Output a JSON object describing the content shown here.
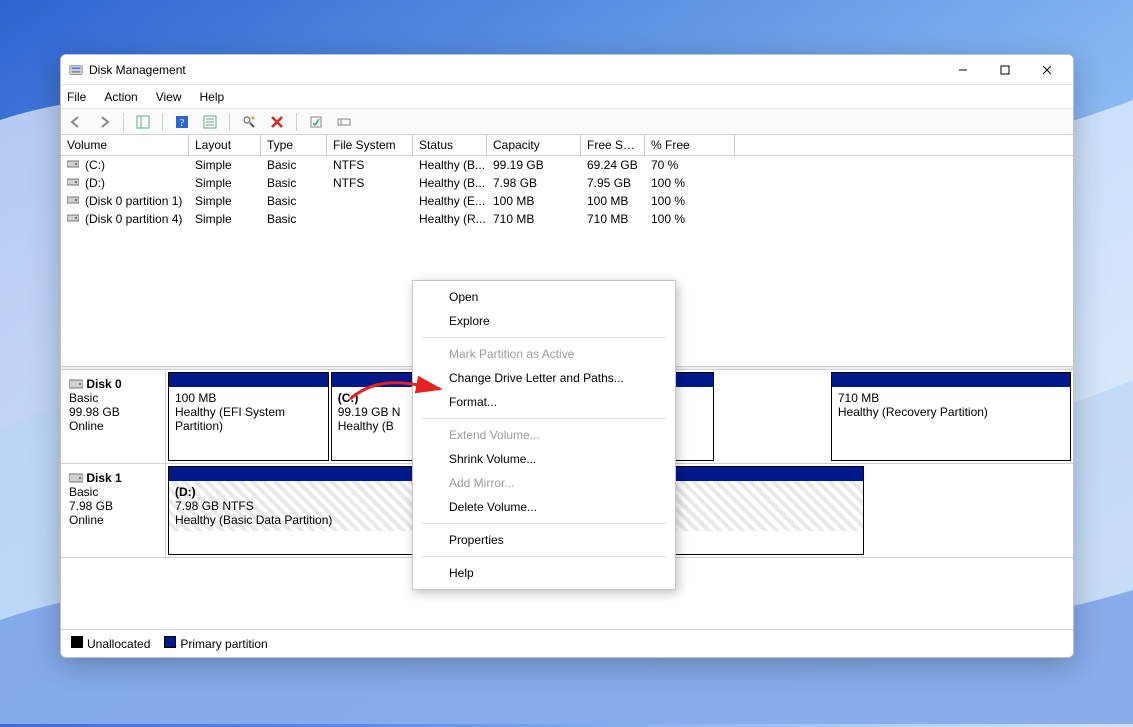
{
  "window": {
    "title": "Disk Management"
  },
  "menubar": {
    "file": "File",
    "action": "Action",
    "view": "View",
    "help": "Help"
  },
  "columns": {
    "volume": "Volume",
    "layout": "Layout",
    "type": "Type",
    "fs": "File System",
    "status": "Status",
    "capacity": "Capacity",
    "freespace": "Free Spa...",
    "pctfree": "% Free"
  },
  "col_widths": {
    "volume": 128,
    "layout": 72,
    "type": 66,
    "fs": 86,
    "status": 74,
    "capacity": 94,
    "freespace": 64,
    "pctfree": 90
  },
  "volumes": [
    {
      "name": "(C:)",
      "layout": "Simple",
      "type": "Basic",
      "fs": "NTFS",
      "status": "Healthy (B...",
      "capacity": "99.19 GB",
      "freespace": "69.24 GB",
      "pctfree": "70 %"
    },
    {
      "name": "(D:)",
      "layout": "Simple",
      "type": "Basic",
      "fs": "NTFS",
      "status": "Healthy (B...",
      "capacity": "7.98 GB",
      "freespace": "7.95 GB",
      "pctfree": "100 %"
    },
    {
      "name": "(Disk 0 partition 1)",
      "layout": "Simple",
      "type": "Basic",
      "fs": "",
      "status": "Healthy (E...",
      "capacity": "100 MB",
      "freespace": "100 MB",
      "pctfree": "100 %"
    },
    {
      "name": "(Disk 0 partition 4)",
      "layout": "Simple",
      "type": "Basic",
      "fs": "",
      "status": "Healthy (R...",
      "capacity": "710 MB",
      "freespace": "710 MB",
      "pctfree": "100 %"
    }
  ],
  "disks": [
    {
      "name": "Disk 0",
      "type": "Basic",
      "size": "99.98 GB",
      "state": "Online",
      "partitions": [
        {
          "label": "",
          "size": "100 MB",
          "status": "Healthy (EFI System Partition)",
          "flex": 1,
          "stripe": false
        },
        {
          "label": "(C:)",
          "size": "99.19 GB N",
          "status": "Healthy (B",
          "flex": 2.4,
          "stripe": false
        },
        {
          "label": "",
          "size": "",
          "status": "",
          "flex": 0.7,
          "stripe": false,
          "covered": true
        },
        {
          "label": "",
          "size": "710 MB",
          "status": "Healthy (Recovery Partition)",
          "flex": 1.5,
          "stripe": false
        }
      ]
    },
    {
      "name": "Disk 1",
      "type": "Basic",
      "size": "7.98 GB",
      "state": "Online",
      "partitions": [
        {
          "label": "(D:)",
          "size": "7.98 GB NTFS",
          "status": "Healthy (Basic Data Partition)",
          "flex": 1,
          "stripe": true
        }
      ],
      "shortrow": true
    }
  ],
  "legend": {
    "unalloc": "Unallocated",
    "primary": "Primary partition"
  },
  "context_menu": [
    {
      "label": "Open",
      "enabled": true
    },
    {
      "label": "Explore",
      "enabled": true
    },
    {
      "sep": true
    },
    {
      "label": "Mark Partition as Active",
      "enabled": false
    },
    {
      "label": "Change Drive Letter and Paths...",
      "enabled": true
    },
    {
      "label": "Format...",
      "enabled": true
    },
    {
      "sep": true
    },
    {
      "label": "Extend Volume...",
      "enabled": false
    },
    {
      "label": "Shrink Volume...",
      "enabled": true
    },
    {
      "label": "Add Mirror...",
      "enabled": false
    },
    {
      "label": "Delete Volume...",
      "enabled": true
    },
    {
      "sep": true
    },
    {
      "label": "Properties",
      "enabled": true
    },
    {
      "sep": true
    },
    {
      "label": "Help",
      "enabled": true
    }
  ]
}
